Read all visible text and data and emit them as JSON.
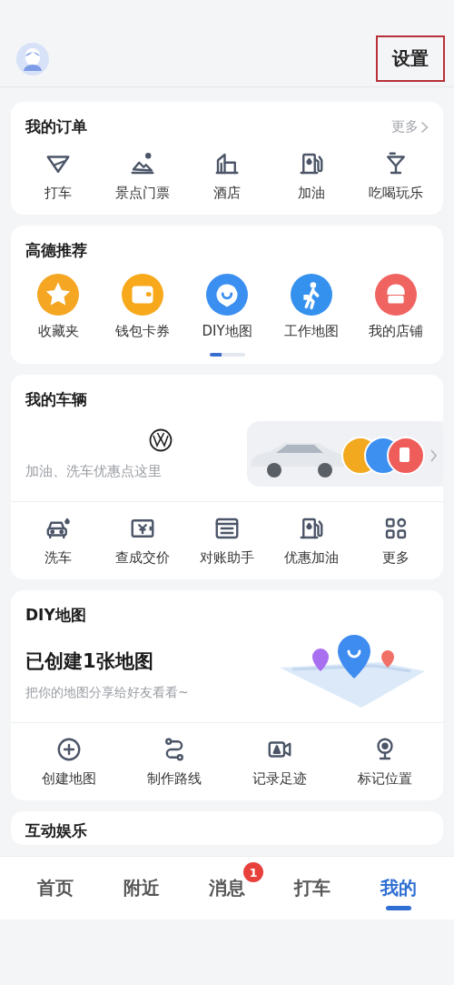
{
  "header": {
    "settings": "设置",
    "highlighted": true
  },
  "cards": [
    {
      "kind": "grid",
      "title": "我的订单",
      "more": "更多",
      "items": [
        {
          "label": "打车",
          "kind": "taxi"
        },
        {
          "label": "景点门票",
          "kind": "scenic"
        },
        {
          "label": "酒店",
          "kind": "hotel"
        },
        {
          "label": "加油",
          "kind": "fuel"
        },
        {
          "label": "吃喝玩乐",
          "kind": "drink"
        }
      ]
    },
    {
      "kind": "recommend",
      "title": "高德推荐",
      "items": [
        {
          "label": "收藏夹",
          "kind": "star",
          "color": "#f5a623"
        },
        {
          "label": "钱包卡券",
          "kind": "wallet",
          "color": "#f7a81b"
        },
        {
          "label": "DIY地图",
          "kind": "bubble",
          "color": "#3b8ff0"
        },
        {
          "label": "工作地图",
          "kind": "walker",
          "color": "#3591ee"
        },
        {
          "label": "我的店铺",
          "kind": "shop",
          "color": "#ef6461"
        }
      ],
      "pages": [
        {
          "selected": true
        },
        {
          "selected": false
        }
      ]
    },
    {
      "kind": "vehicle",
      "title": "我的车辆",
      "hint": "加油、洗车优惠点这里",
      "items": [
        {
          "label": "洗车",
          "kind": "wash"
        },
        {
          "label": "查成交价",
          "kind": "price"
        },
        {
          "label": "对账助手",
          "kind": "toll"
        },
        {
          "label": "优惠加油",
          "kind": "fuel"
        },
        {
          "label": "更多",
          "kind": "apps"
        }
      ]
    },
    {
      "kind": "diy",
      "title": "DIY地图",
      "headline": "已创建1张地图",
      "subtitle": "把你的地图分享给好友看看~",
      "items": [
        {
          "label": "创建地图",
          "kind": "plus"
        },
        {
          "label": "制作路线",
          "kind": "route"
        },
        {
          "label": "记录足迹",
          "kind": "video"
        },
        {
          "label": "标记位置",
          "kind": "pin"
        }
      ]
    },
    {
      "kind": "stub",
      "title": "互动娱乐"
    }
  ],
  "tabs": [
    {
      "label": "首页",
      "selected": false
    },
    {
      "label": "附近",
      "selected": false
    },
    {
      "label": "消息",
      "selected": false,
      "badge": "1"
    },
    {
      "label": "打车",
      "selected": false
    },
    {
      "label": "我的",
      "selected": true
    }
  ]
}
